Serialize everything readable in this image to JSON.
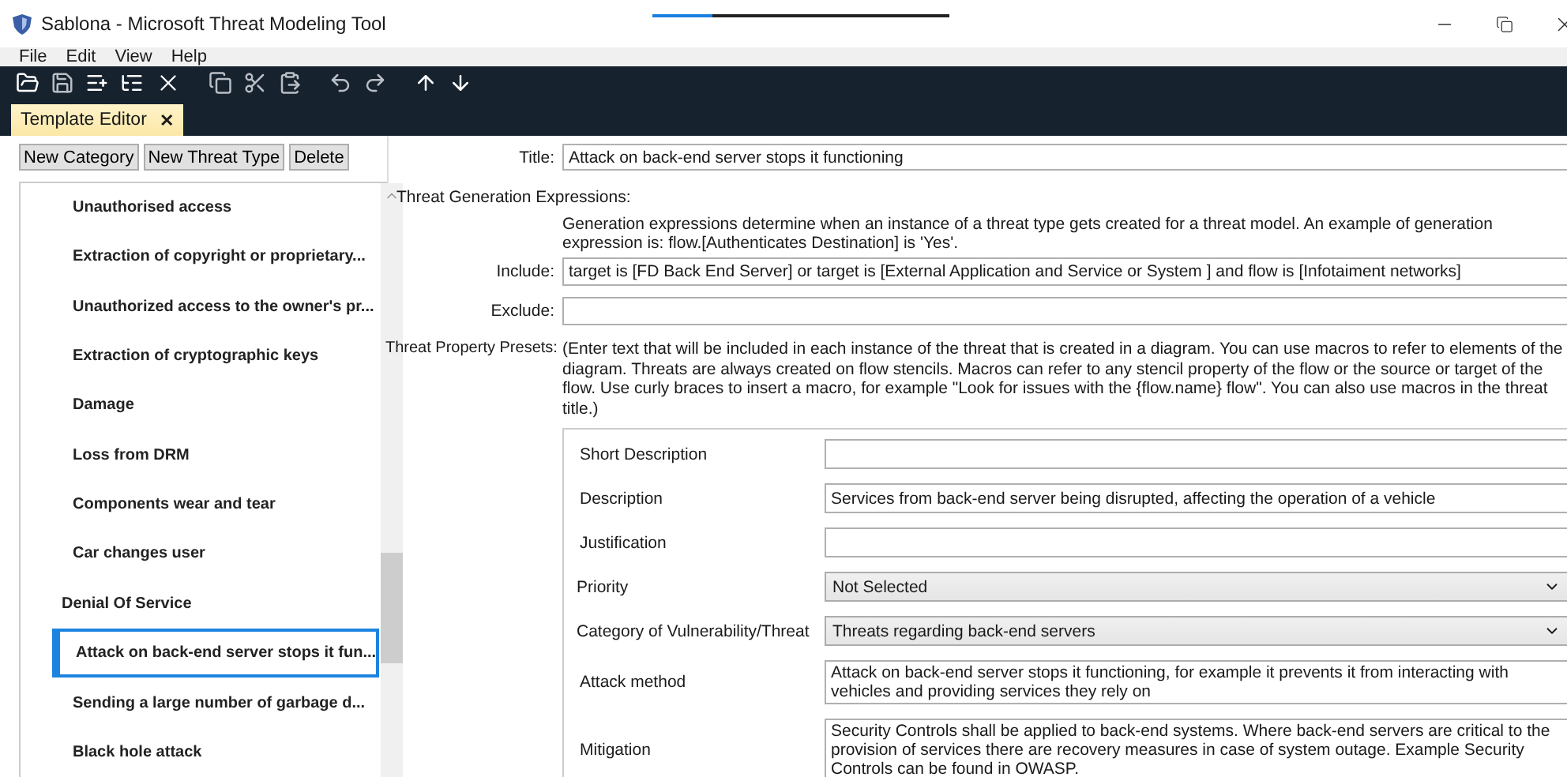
{
  "window": {
    "title": "Sablona - Microsoft Threat Modeling Tool"
  },
  "loading_bar": {
    "level": 0.2
  },
  "menu": [
    "File",
    "Edit",
    "View",
    "Help"
  ],
  "toolbar": [
    {
      "kind": "open",
      "disabled": false
    },
    {
      "kind": "save",
      "disabled": true
    },
    {
      "kind": "add-child",
      "disabled": false
    },
    {
      "kind": "add-sibling",
      "disabled": false
    },
    {
      "kind": "delete",
      "disabled": false
    },
    {
      "kind": "copy",
      "disabled": true
    },
    {
      "kind": "cut",
      "disabled": true
    },
    {
      "kind": "paste",
      "disabled": true
    },
    {
      "kind": "undo",
      "disabled": true
    },
    {
      "kind": "redo",
      "disabled": true
    },
    {
      "kind": "up",
      "disabled": false
    },
    {
      "kind": "down",
      "disabled": false
    }
  ],
  "tabs": [
    {
      "label": "Template Editor",
      "close": "✕",
      "selected": true
    }
  ],
  "left_buttons": [
    "New Category",
    "New Threat Type",
    "Delete"
  ],
  "tree": [
    {
      "children": [
        {
          "label": "Unauthorised access",
          "selected": false
        },
        {
          "label": "Extraction of copyright or proprietary...",
          "selected": false
        },
        {
          "label": "Unauthorized access to the owner's pr...",
          "selected": false
        },
        {
          "label": "Extraction of cryptographic keys",
          "selected": false
        },
        {
          "label": "Damage",
          "selected": false
        },
        {
          "label": "Loss from DRM",
          "selected": false
        },
        {
          "label": "Components wear and tear",
          "selected": false
        },
        {
          "label": "Car changes user",
          "selected": false
        }
      ]
    },
    {
      "label": "Denial Of Service",
      "selected": false,
      "children": [
        {
          "label": "Attack on back-end server stops it fun...",
          "selected": true
        },
        {
          "label": "Sending a large number of garbage d...",
          "selected": false
        },
        {
          "label": "Black hole attack",
          "selected": false
        }
      ]
    }
  ],
  "editor": {
    "title_label": "Title:",
    "title_value": "Attack on back-end server stops it functioning",
    "generation_heading": "Threat Generation Expressions:",
    "generation_help": "Generation expressions determine when an instance of a threat type gets created for a threat model. An example of generation expression is: flow.[Authenticates Destination] is 'Yes'.",
    "include_label": "Include:",
    "include_value": "target is [FD Back End Server] or  target is [External Application and Service or System ] and  flow is [Infotaiment networks]",
    "exclude_label": "Exclude:",
    "presets_label": "Threat Property Presets:",
    "presets_help": "(Enter text that will be included in each instance of the threat that is created in a diagram. You can use macros to refer to elements of the diagram. Threats are always created on flow stencils. Macros can refer to any stencil property of the flow or the source or target of the flow. Use curly braces to insert a macro, for example \"Look for issues with the {flow.name} flow\". You can also use macros in the threat title.)",
    "properties": [
      {
        "kind": "text",
        "label": "Short Description"
      },
      {
        "kind": "text",
        "label": "Description",
        "value": "Services from back-end server being disrupted, affecting the operation of a vehicle"
      },
      {
        "kind": "text",
        "label": "Justification"
      },
      {
        "kind": "select",
        "label": "Priority",
        "value": "Not Selected"
      },
      {
        "kind": "select",
        "label": "Category of Vulnerability/Threat",
        "value": "Threats regarding back-end servers"
      },
      {
        "kind": "multiline",
        "label": "Attack method",
        "value": "Attack on back-end server stops it functioning, for example it prevents it from interacting with vehicles and providing services they rely on"
      },
      {
        "kind": "multiline",
        "label": "Mitigation",
        "value": "Security Controls shall be applied to back-end systems. Where back-end servers are critical to the provision of services there are recovery measures in case of system outage. Example Security Controls can be found in OWASP."
      }
    ]
  }
}
